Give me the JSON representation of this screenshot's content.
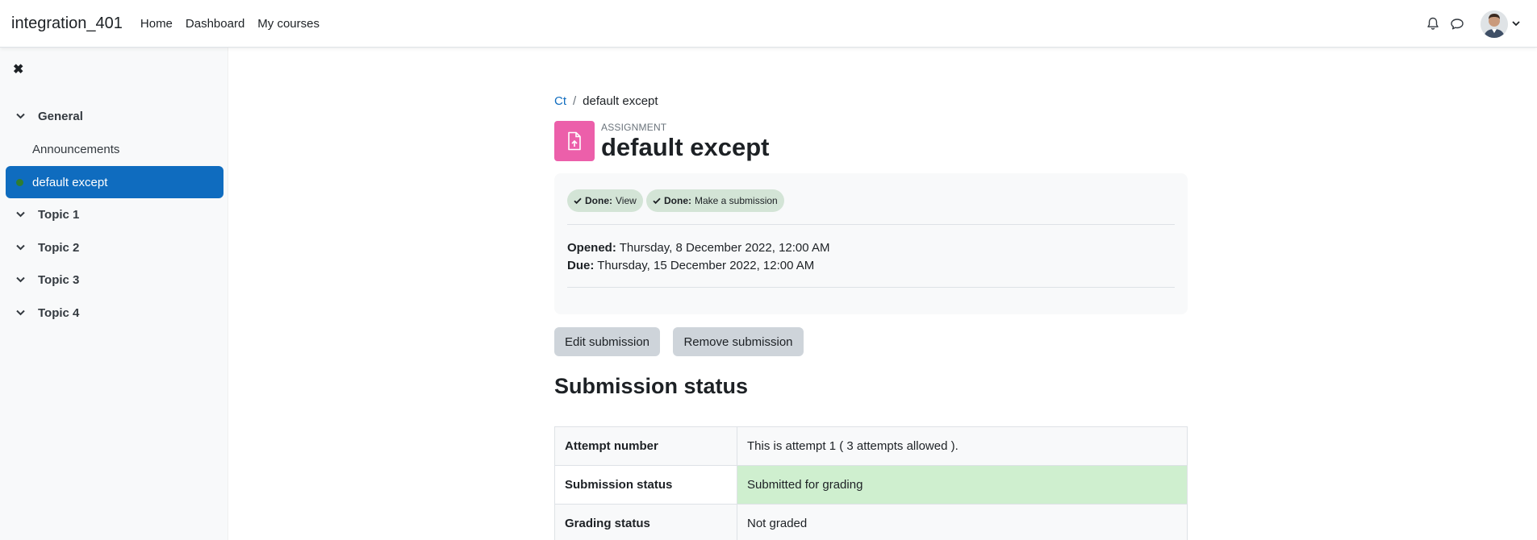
{
  "navbar": {
    "brand": "integration_401",
    "links": [
      "Home",
      "Dashboard",
      "My courses"
    ]
  },
  "sidebar": {
    "sections": [
      {
        "label": "General"
      },
      {
        "label": "Topic 1"
      },
      {
        "label": "Topic 2"
      },
      {
        "label": "Topic 3"
      },
      {
        "label": "Topic 4"
      }
    ],
    "items": [
      {
        "label": "Announcements"
      },
      {
        "label": "default except",
        "active": true
      }
    ]
  },
  "breadcrumb": {
    "course": "Ct",
    "current": "default except"
  },
  "activity": {
    "type": "ASSIGNMENT",
    "title": "default except"
  },
  "completion": [
    {
      "status": "Done:",
      "label": "View"
    },
    {
      "status": "Done:",
      "label": "Make a submission"
    }
  ],
  "dates": {
    "opened_label": "Opened:",
    "opened_value": "Thursday, 8 December 2022, 12:00 AM",
    "due_label": "Due:",
    "due_value": "Thursday, 15 December 2022, 12:00 AM"
  },
  "actions": {
    "edit": "Edit submission",
    "remove": "Remove submission"
  },
  "submission": {
    "heading": "Submission status",
    "rows": [
      {
        "key": "Attempt number",
        "value": "This is attempt 1 ( 3 attempts allowed )."
      },
      {
        "key": "Submission status",
        "value": "Submitted for grading"
      },
      {
        "key": "Grading status",
        "value": "Not graded"
      }
    ]
  },
  "colors": {
    "primary": "#0f6cbf",
    "assignment_icon": "#ec5faa",
    "badge_done": "#d3e4d6",
    "submitted_bg": "#cfefcf"
  }
}
